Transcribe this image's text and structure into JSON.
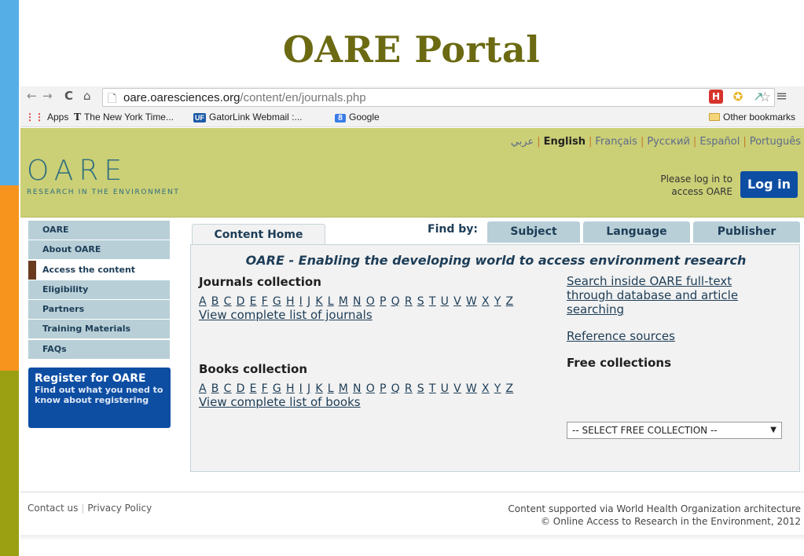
{
  "slide": {
    "title": "OARE Portal",
    "strip_colors": [
      "#55aee6",
      "#f7941d",
      "#9aa012"
    ]
  },
  "browser": {
    "url_host": "oare.oaresciences.org",
    "url_path": "/content/en/journals.php",
    "bookmarks": [
      "Apps",
      "The New York Time...",
      "GatorLink Webmail :...",
      "Google"
    ],
    "other_bookmarks": "Other bookmarks"
  },
  "header": {
    "languages": [
      "عربي",
      "English",
      "Français",
      "Русский",
      "Español",
      "Português"
    ],
    "logo_text": "OARE",
    "logo_sub": "RESEARCH IN THE ENVIRONMENT",
    "login_hint_1": "Please log in to",
    "login_hint_2": "access OARE",
    "login_button": "Log in",
    "header_color": "#cbcf76"
  },
  "leftnav": {
    "items": [
      "OARE",
      "About OARE",
      "Access the content",
      "Eligibility",
      "Partners",
      "Training Materials",
      "FAQs"
    ],
    "active": "Access the content",
    "register_title": "Register for OARE",
    "register_desc": "Find out what you need to know about registering"
  },
  "content": {
    "tab_home": "Content Home",
    "find_by": "Find by:",
    "tab_subject": "Subject",
    "tab_language": "Language",
    "tab_publisher": "Publisher",
    "tagline": "OARE - Enabling the developing world to access environment research",
    "journals_title": "Journals collection",
    "journals_view_all": "View complete list of journals",
    "books_title": "Books collection",
    "books_view_all": "View complete list of books",
    "letters": [
      "A",
      "B",
      "C",
      "D",
      "E",
      "F",
      "G",
      "H",
      "I",
      "J",
      "K",
      "L",
      "M",
      "N",
      "O",
      "P",
      "Q",
      "R",
      "S",
      "T",
      "U",
      "V",
      "W",
      "X",
      "Y",
      "Z"
    ],
    "search_link_1": "Search inside OARE full-text",
    "search_link_2": "through database and article",
    "search_link_3": "searching",
    "reference_sources": "Reference sources",
    "free_collections": "Free collections",
    "select_value": "-- SELECT FREE COLLECTION --"
  },
  "footer": {
    "contact": "Contact us",
    "privacy": "Privacy Policy",
    "right_1": "Content supported via World Health Organization architecture",
    "right_2": "© Online Access to Research in the Environment, 2012"
  }
}
